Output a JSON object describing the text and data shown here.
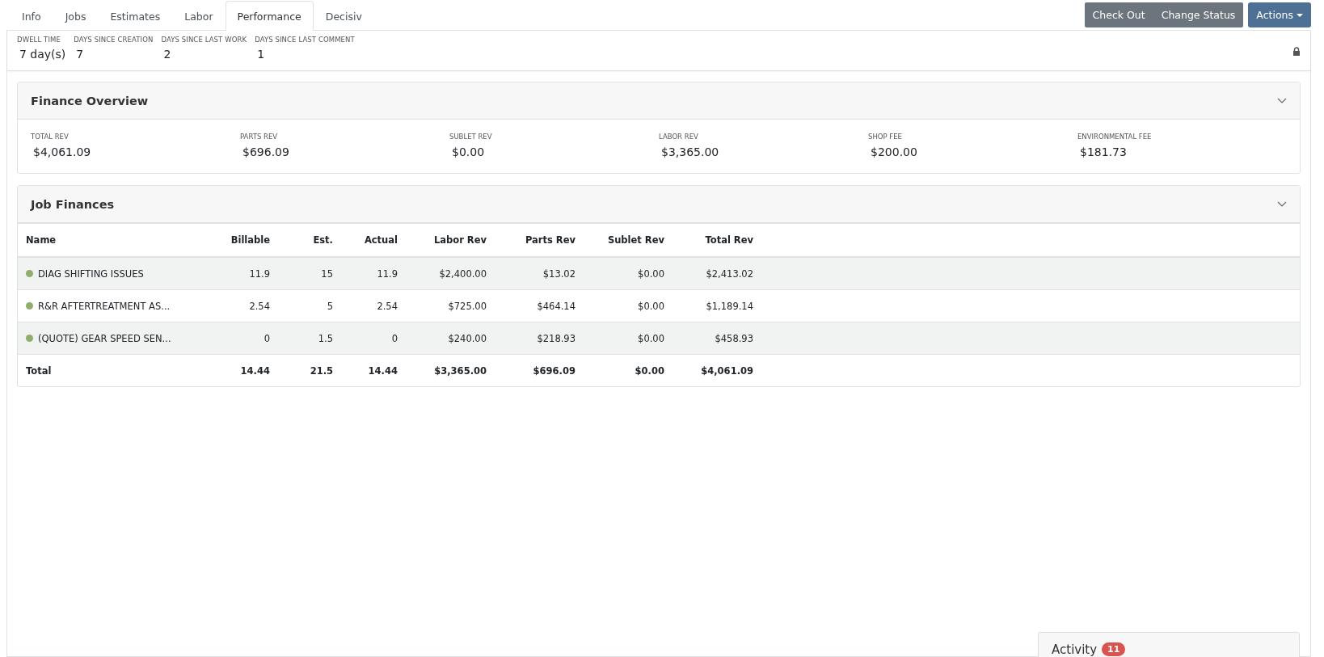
{
  "tabs": [
    {
      "label": "Info",
      "selected": false
    },
    {
      "label": "Jobs",
      "selected": false
    },
    {
      "label": "Estimates",
      "selected": false
    },
    {
      "label": "Labor",
      "selected": false
    },
    {
      "label": "Performance",
      "selected": true
    },
    {
      "label": "Decisiv",
      "selected": false
    }
  ],
  "header_buttons": [
    {
      "label": "Check Out",
      "kind": "secondary"
    },
    {
      "label": "Change Status",
      "kind": "secondary"
    },
    {
      "label": "Actions",
      "kind": "dropdown"
    }
  ],
  "stats": [
    {
      "label": "DWELL TIME",
      "value": "7 day(s)"
    },
    {
      "label": "DAYS SINCE CREATION",
      "value": "7"
    },
    {
      "label": "DAYS SINCE LAST WORK",
      "value": "2"
    },
    {
      "label": "DAYS SINCE LAST COMMENT",
      "value": "1"
    }
  ],
  "finance_overview": {
    "title": "Finance Overview",
    "items": [
      {
        "label": "TOTAL REV",
        "value": "$4,061.09"
      },
      {
        "label": "PARTS REV",
        "value": "$696.09"
      },
      {
        "label": "SUBLET REV",
        "value": "$0.00"
      },
      {
        "label": "LABOR REV",
        "value": "$3,365.00"
      },
      {
        "label": "SHOP FEE",
        "value": "$200.00"
      },
      {
        "label": "ENVIRONMENTAL FEE",
        "value": "$181.73"
      }
    ]
  },
  "job_finances": {
    "title": "Job Finances",
    "columns": [
      "Name",
      "Billable",
      "Est.",
      "Actual",
      "Labor Rev",
      "Parts Rev",
      "Sublet Rev",
      "Total Rev"
    ],
    "rows": [
      {
        "color": "#8fae6c",
        "cells": [
          "DIAG SHIFTING ISSUES",
          "11.9",
          "15",
          "11.9",
          "$2,400.00",
          "$13.02",
          "$0.00",
          "$2,413.02"
        ]
      },
      {
        "color": "#8fae6c",
        "cells": [
          "R&R AFTERTREATMENT AS...",
          "2.54",
          "5",
          "2.54",
          "$725.00",
          "$464.14",
          "$0.00",
          "$1,189.14"
        ]
      },
      {
        "color": "#8fae6c",
        "cells": [
          "(QUOTE) GEAR SPEED SEN...",
          "0",
          "1.5",
          "0",
          "$240.00",
          "$218.93",
          "$0.00",
          "$458.93"
        ]
      }
    ],
    "total": [
      "Total",
      "14.44",
      "21.5",
      "14.44",
      "$3,365.00",
      "$696.09",
      "$0.00",
      "$4,061.09"
    ]
  },
  "activity": {
    "title": "Activity",
    "badge": "11"
  }
}
